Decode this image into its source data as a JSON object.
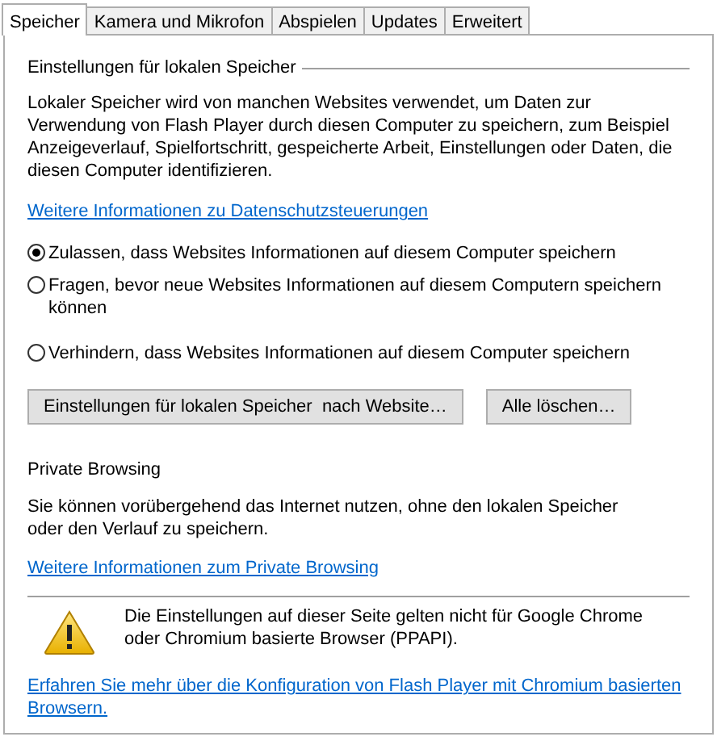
{
  "tabs": [
    {
      "label": "Speicher",
      "selected": true
    },
    {
      "label": "Kamera und Mikrofon",
      "selected": false
    },
    {
      "label": "Abspielen",
      "selected": false
    },
    {
      "label": "Updates",
      "selected": false
    },
    {
      "label": "Erweitert",
      "selected": false
    }
  ],
  "local_storage": {
    "heading": "Einstellungen für lokalen Speicher",
    "description": "Lokaler Speicher wird von manchen Websites verwendet, um Daten zur Verwendung von Flash Player durch diesen Computer zu speichern, zum Beispiel Anzeigeverlauf, Spielfortschritt, gespeicherte Arbeit, Einstellungen oder Daten, die diesen Computer identifizieren.",
    "link": "Weitere Informationen zu Datenschutzsteuerungen",
    "options": [
      {
        "label": "Zulassen, dass Websites Informationen auf diesem Computer speichern",
        "selected": true
      },
      {
        "label": "Fragen, bevor neue Websites Informationen auf diesem Computern speichern können",
        "selected": false
      },
      {
        "label": "Verhindern, dass Websites Informationen auf diesem Computer speichern",
        "selected": false
      }
    ],
    "buttons": [
      "Einstellungen für lokalen Speicher  nach Website…",
      "Alle löschen…"
    ]
  },
  "private_browsing": {
    "heading": "Private Browsing",
    "description": "Sie können vorübergehend das Internet nutzen, ohne den lokalen Speicher oder den Verlauf zu speichern.",
    "link": "Weitere Informationen zum Private Browsing"
  },
  "notice": {
    "text": "Die Einstellungen auf dieser Seite gelten nicht für Google Chrome oder Chromium basierte Browser (PPAPI)."
  },
  "footer_link": "Erfahren Sie mehr über die Konfiguration von Flash Player mit Chromium basierten Browsern."
}
